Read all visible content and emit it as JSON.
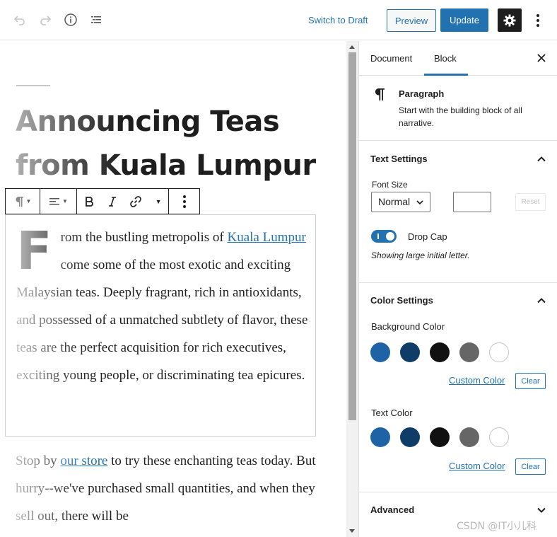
{
  "topbar": {
    "switch_draft": "Switch to Draft",
    "preview": "Preview",
    "update": "Update",
    "icons": [
      "undo-icon",
      "redo-icon",
      "info-icon",
      "list-view-icon",
      "gear-icon",
      "more-vertical-icon"
    ]
  },
  "editor": {
    "title_line1": "Announcing Teas",
    "title_line2": "from Kuala Lumpur",
    "paragraph1": {
      "drop_cap": "F",
      "before_link": "rom the bustling metropolis of ",
      "link": "Kuala Lumpur",
      "after_link": " come some of the most exotic and exciting Malaysian teas. Deeply fragrant, rich in antioxidants, and possessed of a unmatched subtlety of flavor, these teas are the perfect acquisition for rich executives, exciting young people, or discriminating tea epicures."
    },
    "paragraph2": {
      "before_link": "Stop by ",
      "link": "our store",
      "after_link": " to try these enchanting teas today. But hurry--we've purchased small quantities, and when they sell out, there will be"
    }
  },
  "sidebar": {
    "tabs": [
      "Document",
      "Block"
    ],
    "active_tab": "Block",
    "block": {
      "name": "Paragraph",
      "description": "Start with the building block of all narrative."
    },
    "text_settings": {
      "title": "Text Settings",
      "font_size_label": "Font Size",
      "font_size_value": "Normal",
      "custom_size_value": "",
      "reset": "Reset",
      "drop_cap_label": "Drop Cap",
      "drop_cap_help": "Showing large initial letter.",
      "drop_cap_on": true
    },
    "color_settings": {
      "title": "Color Settings",
      "background_label": "Background Color",
      "text_label": "Text Color",
      "palette": [
        "#1e63a5",
        "#0f3d68",
        "#111111",
        "#666666",
        "#ffffff"
      ],
      "custom_color": "Custom Color",
      "clear": "Clear"
    },
    "advanced": {
      "title": "Advanced"
    }
  },
  "watermark": "CSDN @IT小儿科",
  "colors": {
    "accent": "#2271b1",
    "dark": "#1e1e1e"
  }
}
